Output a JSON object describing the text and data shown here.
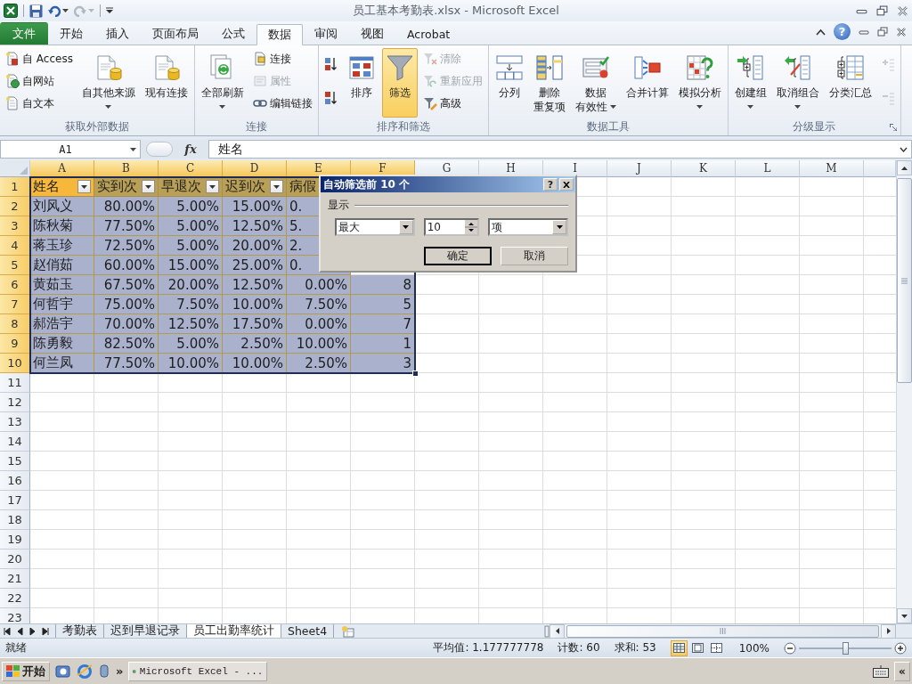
{
  "title_bar": {
    "title": "员工基本考勤表.xlsx - Microsoft Excel"
  },
  "ribbon_tabs": [
    {
      "label": "文件",
      "kind": "file",
      "selected": false
    },
    {
      "label": "开始",
      "kind": "tab",
      "selected": false
    },
    {
      "label": "插入",
      "kind": "tab",
      "selected": false
    },
    {
      "label": "页面布局",
      "kind": "tab",
      "selected": false
    },
    {
      "label": "公式",
      "kind": "tab",
      "selected": false
    },
    {
      "label": "数据",
      "kind": "tab",
      "selected": true
    },
    {
      "label": "审阅",
      "kind": "tab",
      "selected": false
    },
    {
      "label": "视图",
      "kind": "tab",
      "selected": false
    },
    {
      "label": "Acrobat",
      "kind": "tab",
      "selected": false
    }
  ],
  "ribbon_help": "?",
  "ribbon_groups": [
    {
      "label": "获取外部数据",
      "launcher": false,
      "items": [
        {
          "kind": "stack",
          "buttons": [
            {
              "label": "自 Access",
              "disabled": false
            },
            {
              "label": "自网站",
              "disabled": false
            },
            {
              "label": "自文本",
              "disabled": false
            }
          ]
        },
        {
          "kind": "large",
          "lines": [
            "自其他来源"
          ],
          "dropdown": true,
          "selected": false
        },
        {
          "kind": "large",
          "lines": [
            "现有连接"
          ],
          "dropdown": false,
          "selected": false
        }
      ]
    },
    {
      "label": "连接",
      "launcher": false,
      "items": [
        {
          "kind": "large",
          "lines": [
            "全部刷新"
          ],
          "dropdown": true,
          "selected": false
        },
        {
          "kind": "stack",
          "buttons": [
            {
              "label": "连接",
              "disabled": false
            },
            {
              "label": "属性",
              "disabled": true
            },
            {
              "label": "编辑链接",
              "disabled": false
            }
          ]
        }
      ]
    },
    {
      "label": "排序和筛选",
      "launcher": false,
      "items": [
        {
          "kind": "icons",
          "buttons": [
            {
              "disabled": false
            },
            {
              "disabled": false
            }
          ]
        },
        {
          "kind": "large",
          "lines": [
            "排序"
          ],
          "dropdown": false,
          "selected": false
        },
        {
          "kind": "large",
          "lines": [
            "筛选"
          ],
          "dropdown": false,
          "selected": true
        },
        {
          "kind": "stack",
          "buttons": [
            {
              "label": "清除",
              "disabled": true
            },
            {
              "label": "重新应用",
              "disabled": true
            },
            {
              "label": "高级",
              "disabled": false
            }
          ]
        }
      ]
    },
    {
      "label": "数据工具",
      "launcher": false,
      "items": [
        {
          "kind": "large",
          "lines": [
            "分列"
          ],
          "dropdown": false,
          "selected": false
        },
        {
          "kind": "large",
          "lines": [
            "删除",
            "重复项"
          ],
          "dropdown": false,
          "selected": false
        },
        {
          "kind": "large",
          "lines": [
            "数据",
            "有效性"
          ],
          "dropdown": true,
          "selected": false
        },
        {
          "kind": "large",
          "lines": [
            "合并计算"
          ],
          "dropdown": false,
          "selected": false
        },
        {
          "kind": "large",
          "lines": [
            "模拟分析"
          ],
          "dropdown": true,
          "selected": false
        }
      ]
    },
    {
      "label": "分级显示",
      "launcher": true,
      "items": [
        {
          "kind": "large",
          "lines": [
            "创建组"
          ],
          "dropdown": true,
          "selected": false
        },
        {
          "kind": "large",
          "lines": [
            "取消组合"
          ],
          "dropdown": true,
          "selected": false
        },
        {
          "kind": "large",
          "lines": [
            "分类汇总"
          ],
          "dropdown": false,
          "selected": false
        },
        {
          "kind": "icons",
          "buttons": [
            {
              "disabled": true
            },
            {
              "disabled": true
            }
          ]
        }
      ]
    }
  ],
  "formula_bar": {
    "name_box": "A1",
    "function_label": "fx",
    "value": "姓名"
  },
  "grid": {
    "columns": [
      {
        "label": "A",
        "highlighted": true
      },
      {
        "label": "B",
        "highlighted": true
      },
      {
        "label": "C",
        "highlighted": true
      },
      {
        "label": "D",
        "highlighted": true
      },
      {
        "label": "E",
        "highlighted": true
      },
      {
        "label": "F",
        "highlighted": true
      },
      {
        "label": "G",
        "highlighted": false
      },
      {
        "label": "H",
        "highlighted": false
      },
      {
        "label": "I",
        "highlighted": false
      },
      {
        "label": "J",
        "highlighted": false
      },
      {
        "label": "K",
        "highlighted": false
      },
      {
        "label": "L",
        "highlighted": false
      },
      {
        "label": "M",
        "highlighted": false
      }
    ],
    "rows": [
      {
        "label": "1",
        "highlighted": true,
        "kind": "header",
        "cells": [
          {
            "text": "姓名",
            "filter": true
          },
          {
            "text": "实到次",
            "filter": true
          },
          {
            "text": "早退次",
            "filter": true
          },
          {
            "text": "迟到次",
            "filter": true
          },
          {
            "text": "病假",
            "filter": false
          }
        ]
      },
      {
        "label": "2",
        "highlighted": true,
        "kind": "data",
        "cells": [
          "刘风义",
          "80.00%",
          "5.00%",
          "15.00%",
          "0."
        ]
      },
      {
        "label": "3",
        "highlighted": true,
        "kind": "data",
        "cells": [
          "陈秋菊",
          "77.50%",
          "5.00%",
          "12.50%",
          "5."
        ]
      },
      {
        "label": "4",
        "highlighted": true,
        "kind": "data",
        "cells": [
          "蒋玉珍",
          "72.50%",
          "5.00%",
          "20.00%",
          "2."
        ]
      },
      {
        "label": "5",
        "highlighted": true,
        "kind": "data",
        "cells": [
          "赵俏茹",
          "60.00%",
          "15.00%",
          "25.00%",
          "0."
        ]
      },
      {
        "label": "6",
        "highlighted": true,
        "kind": "data",
        "cells": [
          "黄茹玉",
          "67.50%",
          "20.00%",
          "12.50%",
          "0.00%",
          "8"
        ]
      },
      {
        "label": "7",
        "highlighted": true,
        "kind": "data",
        "cells": [
          "何哲宇",
          "75.00%",
          "7.50%",
          "10.00%",
          "7.50%",
          "5"
        ]
      },
      {
        "label": "8",
        "highlighted": true,
        "kind": "data",
        "cells": [
          "郝浩宇",
          "70.00%",
          "12.50%",
          "17.50%",
          "0.00%",
          "7"
        ]
      },
      {
        "label": "9",
        "highlighted": true,
        "kind": "data",
        "cells": [
          "陈勇毅",
          "82.50%",
          "5.00%",
          "2.50%",
          "10.00%",
          "1"
        ]
      },
      {
        "label": "10",
        "highlighted": true,
        "kind": "data",
        "cells": [
          "何兰凤",
          "77.50%",
          "10.00%",
          "10.00%",
          "2.50%",
          "3"
        ]
      },
      {
        "label": "11",
        "highlighted": false,
        "kind": "data"
      },
      {
        "label": "12",
        "highlighted": false,
        "kind": "data"
      },
      {
        "label": "13",
        "highlighted": false,
        "kind": "data"
      },
      {
        "label": "14",
        "highlighted": false,
        "kind": "data"
      },
      {
        "label": "15",
        "highlighted": false,
        "kind": "data"
      },
      {
        "label": "16",
        "highlighted": false,
        "kind": "data"
      },
      {
        "label": "17",
        "highlighted": false,
        "kind": "data"
      },
      {
        "label": "18",
        "highlighted": false,
        "kind": "data"
      },
      {
        "label": "19",
        "highlighted": false,
        "kind": "data"
      },
      {
        "label": "20",
        "highlighted": false,
        "kind": "data"
      },
      {
        "label": "21",
        "highlighted": false,
        "kind": "data"
      },
      {
        "label": "22",
        "highlighted": false,
        "kind": "data"
      },
      {
        "label": "23",
        "highlighted": false,
        "kind": "data"
      }
    ]
  },
  "dialog": {
    "title": "自动筛选前 10 个",
    "help": "?",
    "group_label": "显示",
    "mode": "最大",
    "count": "10",
    "unit": "项",
    "buttons": [
      {
        "label": "确定",
        "default": true
      },
      {
        "label": "取消",
        "default": false
      }
    ]
  },
  "sheet_tabs": [
    {
      "label": "考勤表",
      "selected": false
    },
    {
      "label": "迟到早退记录",
      "selected": false
    },
    {
      "label": "员工出勤率统计",
      "selected": true
    },
    {
      "label": "Sheet4",
      "selected": false
    }
  ],
  "status_bar": {
    "mode": "就绪",
    "average": "平均值: 1.177777778",
    "count": "计数: 60",
    "sum": "求和: 53",
    "views": [
      {
        "selected": true
      },
      {
        "selected": false
      },
      {
        "selected": false
      }
    ],
    "zoom": "100%",
    "zoom_slider": {
      "level": 0.5
    }
  },
  "taskbar": {
    "start": "开始",
    "more": "»",
    "task": "Microsoft Excel - ...",
    "tray_toggle": "«"
  }
}
